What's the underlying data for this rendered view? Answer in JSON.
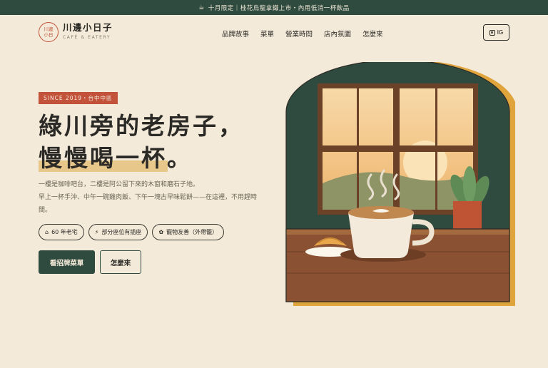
{
  "announcement": {
    "icon": "coffee-cup-icon",
    "text": "十月限定｜桂花烏龍拿鐵上市・內用低消一杯飲品"
  },
  "brand": {
    "badge_line1": "川邊",
    "badge_line2": "小日",
    "name": "川邊小日子",
    "tagline": "CAFÉ & EATERY",
    "accent_color": "#c2533a",
    "primary_color": "#2f4a3e"
  },
  "nav": {
    "items": [
      "品牌故事",
      "菜單",
      "營業時間",
      "店內氛圍",
      "怎麼來"
    ],
    "ig_label": "IG"
  },
  "hero": {
    "since": "SINCE 2019・台中中區",
    "headline_line1": "綠川旁的老房子，",
    "headline_line2_highlight": "慢慢喝一杯",
    "headline_line2_end": "。",
    "desc_line1": "一樓是咖啡吧台，二樓是阿公留下來的木窗和磨石子地。",
    "desc_line2": "早上一杯手沖、中午一碗雞肉飯、下午一塊古早味鬆餅——在這裡，不用趕時間。",
    "tags": [
      {
        "icon": "house-icon",
        "glyph": "⌂",
        "label": "60 年老宅"
      },
      {
        "icon": "plug-icon",
        "glyph": "⚡",
        "label": "部分座位有插座"
      },
      {
        "icon": "paw-icon",
        "glyph": "✿",
        "label": "寵物友善（外帶籠）"
      }
    ],
    "primary_button": "看招牌菜單",
    "secondary_button": "怎麼來"
  }
}
